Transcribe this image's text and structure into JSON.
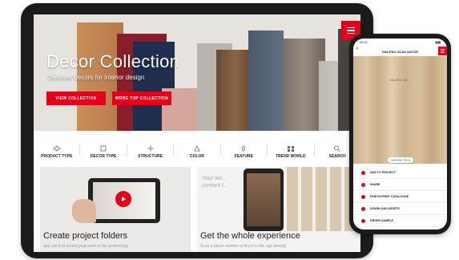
{
  "tablet": {
    "hero": {
      "title": "Decor Collection",
      "subtitle": "Discover decors for interior design",
      "btn_collection": "VIEW COLLECTION",
      "btn_top": "WRBE TOP COLLECTION"
    },
    "nav": [
      {
        "label": "PRODUCT TYPE",
        "icon": "product-type-icon"
      },
      {
        "label": "DECOR TYPE",
        "icon": "decor-type-icon"
      },
      {
        "label": "STRUCTURE",
        "icon": "structure-icon"
      },
      {
        "label": "COLOR",
        "icon": "color-icon"
      },
      {
        "label": "FEATURE",
        "icon": "feature-icon"
      },
      {
        "label": "TREND WORLD",
        "icon": "trend-world-icon"
      },
      {
        "label": "SEARCH",
        "icon": "search-icon"
      }
    ],
    "cards": [
      {
        "title": "Create project folders",
        "subtitle": "and use it to record your work or the perfect buy"
      },
      {
        "title": "Get the whole experience",
        "subtitle": "Scan a decor number to find it in the app directly"
      }
    ],
    "card2_overlay_text": "Your wo... contant f..."
  },
  "phone": {
    "status_left": "09:41",
    "status_right": "▮▮▮",
    "header_title": "HALIFAX OCAK NATUR",
    "back": "‹",
    "wood_tag": "HALIFAX OAK",
    "chip": "CHOOSE TOOL",
    "list": [
      "ADD TO PROJECT",
      "SHARE",
      "FIND IN PRINT CATALOGUE",
      "DOWNLOAD ASSETS",
      "ORDER SAMPLE"
    ]
  },
  "colors": {
    "accent": "#e2001a",
    "device": "#1b1b1c"
  }
}
